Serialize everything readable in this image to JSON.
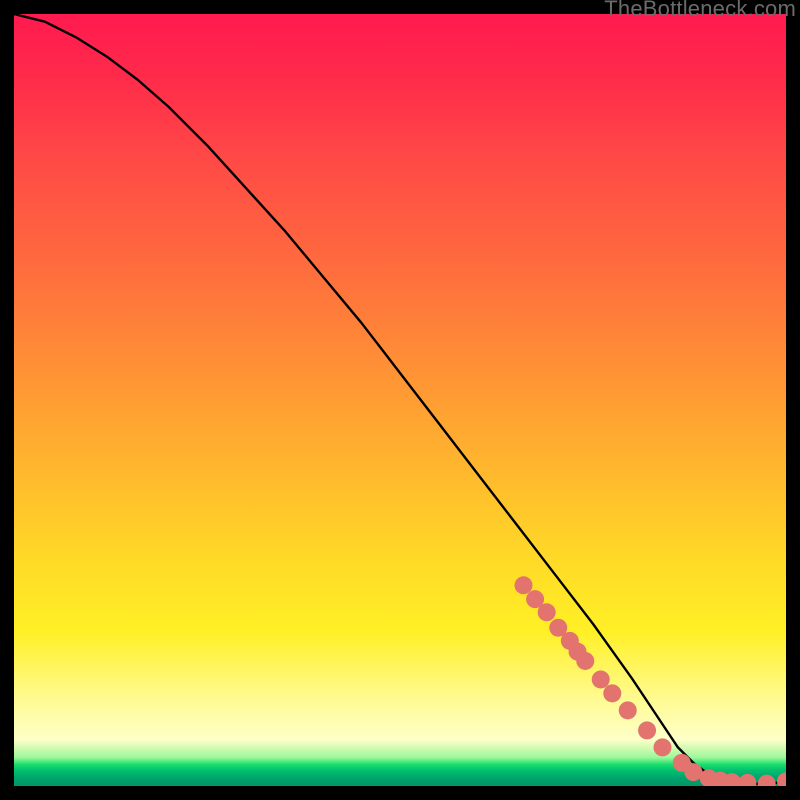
{
  "watermark": "TheBottleneck.com",
  "chart_data": {
    "type": "line",
    "title": "",
    "xlabel": "",
    "ylabel": "",
    "xlim": [
      0,
      100
    ],
    "ylim": [
      0,
      100
    ],
    "grid": false,
    "legend": false,
    "annotations": [],
    "series": [
      {
        "name": "curve",
        "kind": "line",
        "color": "#000000",
        "x": [
          0,
          4,
          8,
          12,
          16,
          20,
          25,
          30,
          35,
          40,
          45,
          50,
          55,
          60,
          65,
          70,
          75,
          80,
          84,
          86,
          88,
          90,
          92,
          94,
          96,
          98,
          100
        ],
        "y": [
          100,
          99,
          97,
          94.5,
          91.5,
          88,
          83,
          77.5,
          72,
          66,
          60,
          53.5,
          47,
          40.5,
          34,
          27.5,
          21,
          14,
          8,
          5,
          3,
          1.5,
          0.7,
          0.4,
          0.3,
          0.3,
          0.6
        ]
      },
      {
        "name": "dots",
        "kind": "scatter",
        "color": "#e2736e",
        "x": [
          66,
          67.5,
          69,
          70.5,
          72,
          73,
          74,
          76,
          77.5,
          79.5,
          82,
          84,
          86.5,
          88,
          90,
          91.5,
          93,
          95,
          97.5,
          100
        ],
        "y": [
          26,
          24.2,
          22.5,
          20.5,
          18.8,
          17.4,
          16.2,
          13.8,
          12,
          9.8,
          7.2,
          5,
          3,
          1.8,
          1,
          0.7,
          0.5,
          0.4,
          0.3,
          0.6
        ]
      }
    ],
    "background_gradient": {
      "direction": "vertical",
      "stops": [
        {
          "pos": 0.0,
          "color": "#ff1a4f"
        },
        {
          "pos": 0.45,
          "color": "#ff8e36"
        },
        {
          "pos": 0.8,
          "color": "#fff026"
        },
        {
          "pos": 0.94,
          "color": "#fdffc8"
        },
        {
          "pos": 0.97,
          "color": "#1bdf6e"
        },
        {
          "pos": 1.0,
          "color": "#019764"
        }
      ]
    }
  }
}
